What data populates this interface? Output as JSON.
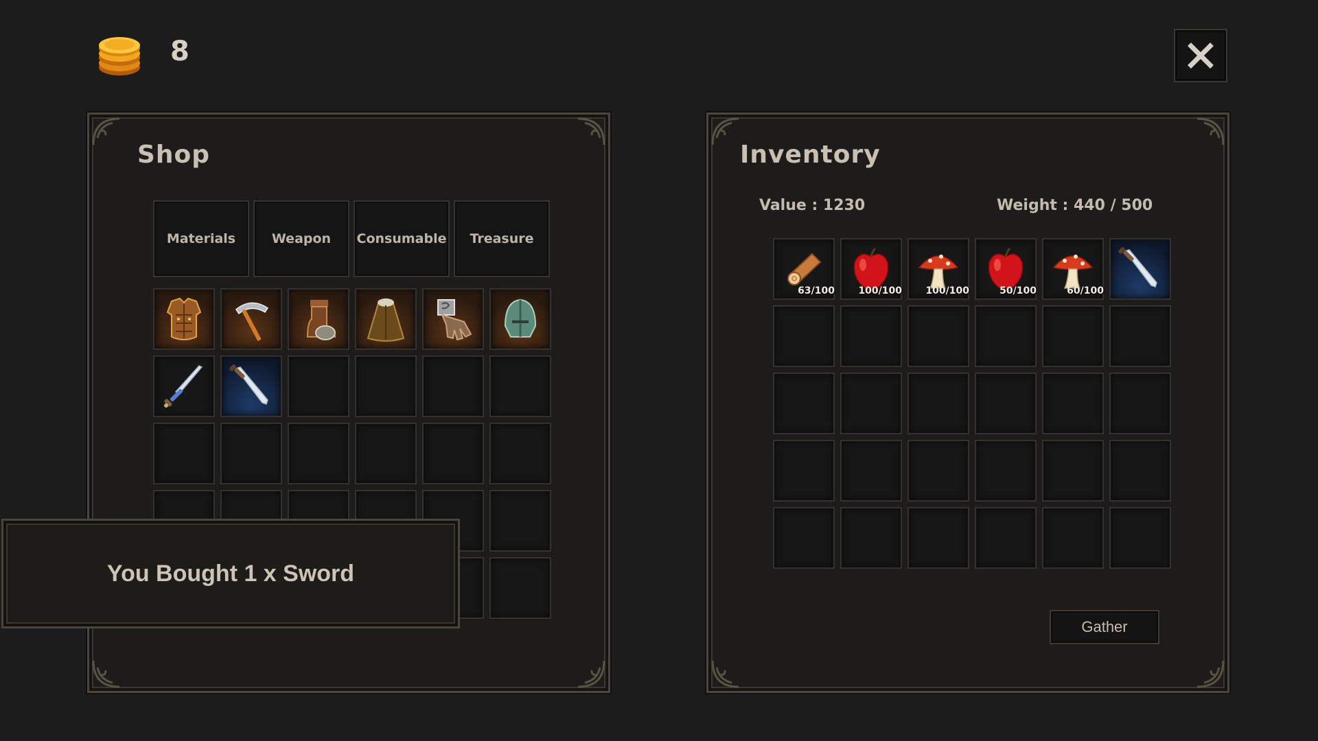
{
  "currency": {
    "gold": "8",
    "icon": "gold-coin-stack-icon"
  },
  "close": {
    "icon": "close-icon"
  },
  "shop": {
    "title": "Shop",
    "tabs": [
      "Materials",
      "Weapon",
      "Consumable",
      "Treasure"
    ],
    "items": [
      {
        "icon": "chest-armor-icon",
        "bg": "warm"
      },
      {
        "icon": "pickaxe-icon",
        "bg": "warm"
      },
      {
        "icon": "boots-icon",
        "bg": "warm"
      },
      {
        "icon": "cloak-icon",
        "bg": "warm"
      },
      {
        "icon": "gauntlet-icon",
        "bg": "warm"
      },
      {
        "icon": "helmet-icon",
        "bg": "warm"
      },
      {
        "icon": "longsword-icon",
        "bg": "plain"
      },
      {
        "icon": "sword-icon",
        "bg": "blue"
      }
    ],
    "slot_count": 30
  },
  "inventory": {
    "title": "Inventory",
    "value_label": "Value :  1230",
    "weight_label": "Weight :  440 / 500",
    "items": [
      {
        "icon": "wood-log-icon",
        "qty": "63/100"
      },
      {
        "icon": "red-apple-icon",
        "qty": "100/100"
      },
      {
        "icon": "red-mushroom-icon",
        "qty": "100/100"
      },
      {
        "icon": "red-apple-icon",
        "qty": "50/100"
      },
      {
        "icon": "red-mushroom-icon",
        "qty": "60/100"
      },
      {
        "icon": "sword-icon",
        "qty": "",
        "bg": "blue"
      }
    ],
    "slot_count": 30,
    "gather_label": "Gather"
  },
  "notification": {
    "text": "You Bought 1 x Sword"
  }
}
